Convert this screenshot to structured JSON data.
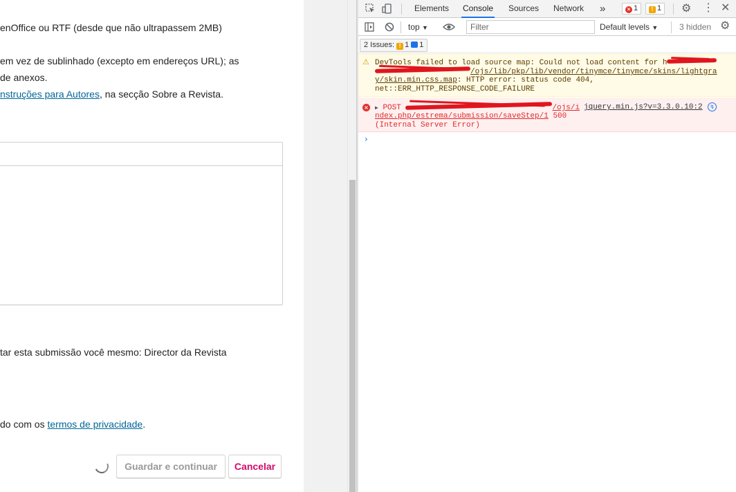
{
  "page": {
    "lines": [
      {
        "text": "enOffice ou RTF (desde que não ultrapassem 2MB)"
      },
      {
        "text": " em vez de sublinhado (excepto em endereços URL); as"
      },
      {
        "text": "de anexos."
      }
    ],
    "instructions_link": "nstruções para Autores",
    "instructions_after": ", na secção Sobre a Revista.",
    "submit_self_text": "tar esta submissão você mesmo: Director da Revista",
    "privacy_before": "do com os ",
    "privacy_link": "termos de privacidade",
    "privacy_after": ".",
    "save_button": "Guardar e continuar",
    "cancel_button": "Cancelar"
  },
  "devtools": {
    "tabs": [
      "Elements",
      "Console",
      "Sources",
      "Network"
    ],
    "more_tabs": "»",
    "error_count": "1",
    "warning_count": "1",
    "context": "top",
    "filter_placeholder": "Filter",
    "levels": "Default levels",
    "hidden": "3 hidden",
    "issues_label": "2 Issues:",
    "issues_warn": "1",
    "issues_info": "1",
    "messages": {
      "warning": {
        "line1_a": "DevTools failed to load source map: Could not load content for h",
        "line2_b": "/ojs/lib/pkp/lib/vendor/tinymce/tinymce/skins/lightgra",
        "line3_a": "y/skin.min.css.map",
        "line3_b": ": HTTP error: status code 404,",
        "line4": "net::ERR_HTTP_RESPONSE_CODE_FAILURE"
      },
      "error": {
        "method": "POST",
        "line1_b": "/ojs/i",
        "source": "jquery.min.js?v=3.3.0.10:2",
        "line2_url": "ndex.php/estrema/submission/saveStep/1",
        "line2_status": " 500",
        "line3": "(Internal Server Error)"
      }
    },
    "colors": {
      "accent": "#1a73e8",
      "error": "#e02828",
      "warning": "#f2a600"
    }
  }
}
